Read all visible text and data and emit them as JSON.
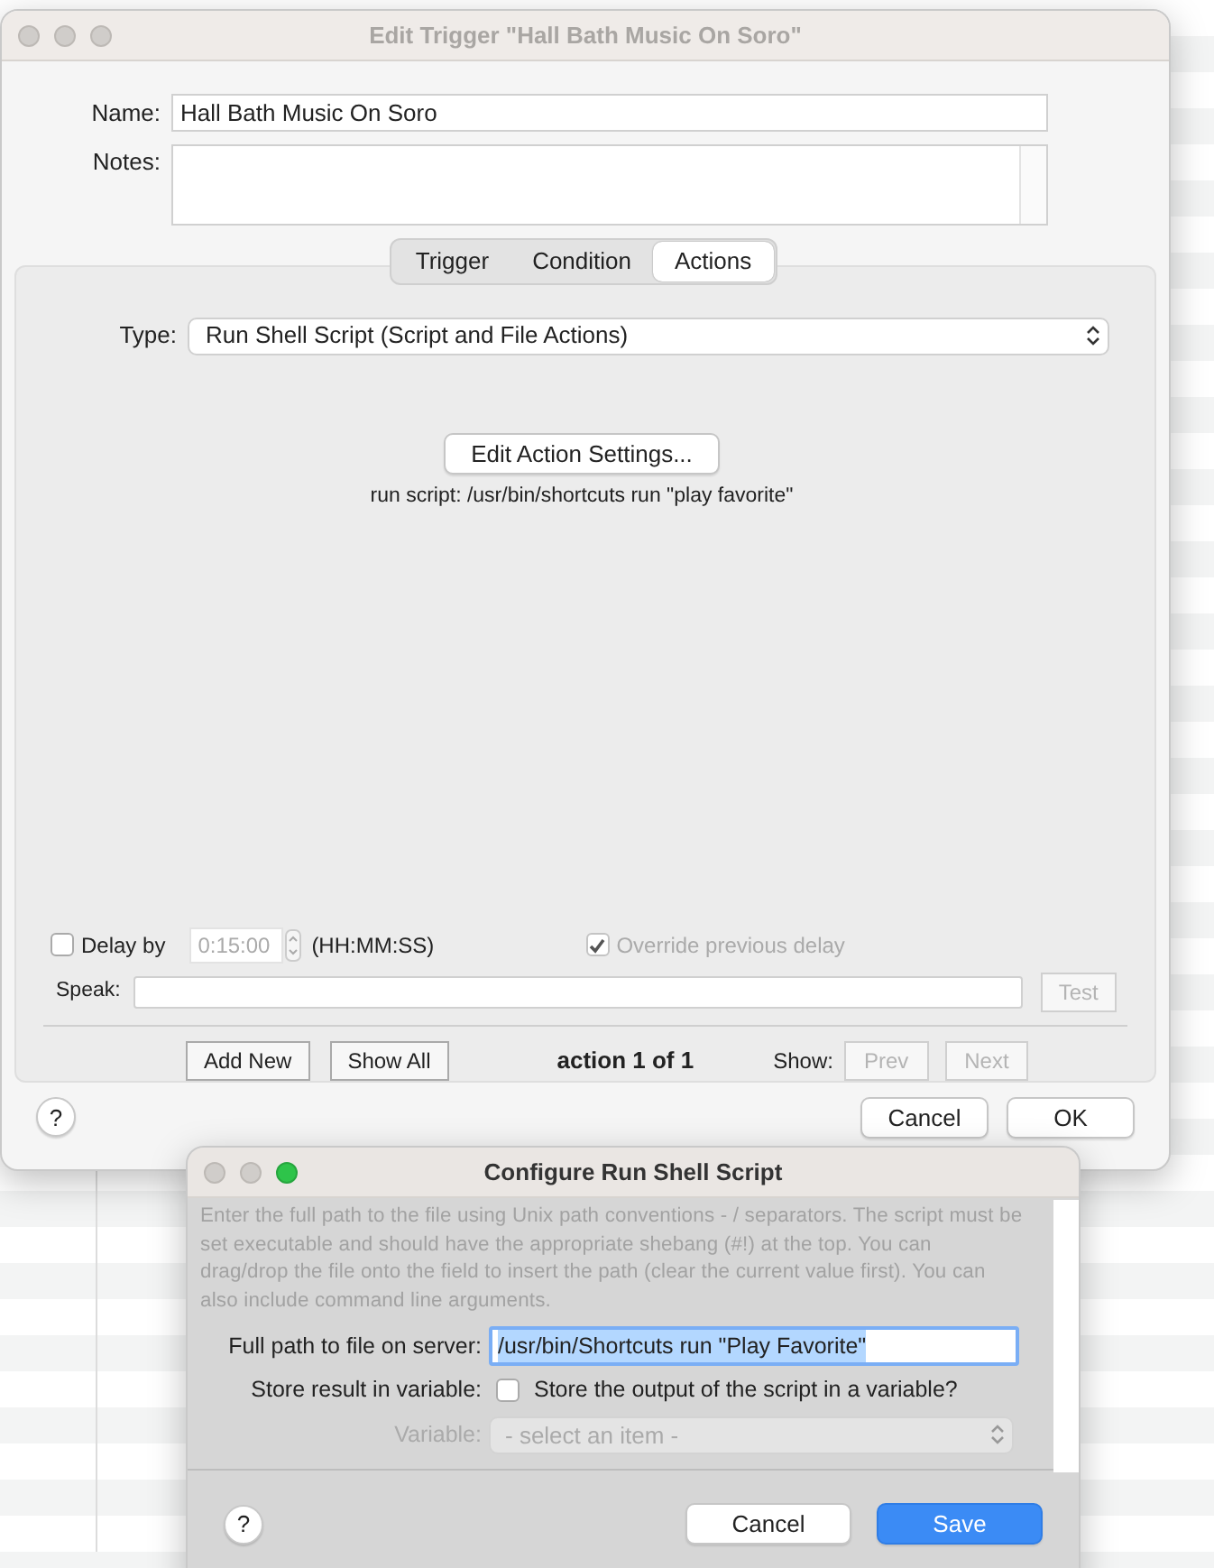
{
  "main_window": {
    "title": "Edit Trigger \"Hall Bath Music On Soro\"",
    "active": false,
    "name": {
      "label": "Name:",
      "value": "Hall Bath Music On Soro"
    },
    "notes": {
      "label": "Notes:"
    },
    "tabs": [
      {
        "label": "Trigger",
        "selected": false
      },
      {
        "label": "Condition",
        "selected": false
      },
      {
        "label": "Actions",
        "selected": true
      }
    ],
    "type": {
      "label": "Type:",
      "value": "Run Shell Script (Script and File Actions)"
    },
    "edit_button": "Edit Action Settings...",
    "summary": "run script: /usr/bin/shortcuts run \"play favorite\"",
    "delay": {
      "label": "Delay by",
      "checked": false,
      "value": "0:15:00",
      "format": "(HH:MM:SS)",
      "disabled": true
    },
    "override": {
      "label": "Override previous delay",
      "checked": true,
      "disabled": true
    },
    "speak": {
      "label": "Speak:",
      "test": {
        "label": "Test",
        "disabled": true
      }
    },
    "nav": {
      "add_new": "Add New",
      "show_all": "Show All",
      "position": "action 1 of 1",
      "show_label": "Show:",
      "prev": {
        "label": "Prev",
        "disabled": true
      },
      "next": {
        "label": "Next",
        "disabled": true
      }
    },
    "help": "?",
    "buttons": [
      {
        "label": "Cancel",
        "primary": false
      },
      {
        "label": "OK",
        "primary": false
      }
    ]
  },
  "config_dialog": {
    "title": "Configure Run Shell Script",
    "active": true,
    "description": "Enter the full path to the file using Unix path conventions - / separators. The script must be set executable and should have the appropriate shebang (#!) at the top. You can drag/drop the file onto the field to insert the path (clear the current value first). You can also include command line arguments.",
    "path": {
      "label": "Full path to file on server:",
      "value": "/usr/bin/Shortcuts run \"Play Favorite\"",
      "text_selected": true
    },
    "store": {
      "label": "Store result in variable:",
      "option": "Store the output of the script in a variable?",
      "checked": false
    },
    "variable": {
      "label": "Variable:",
      "placeholder": "- select an item -",
      "disabled": true
    },
    "help": "?",
    "buttons": [
      {
        "label": "Cancel",
        "primary": false
      },
      {
        "label": "Save",
        "primary": true
      }
    ]
  }
}
